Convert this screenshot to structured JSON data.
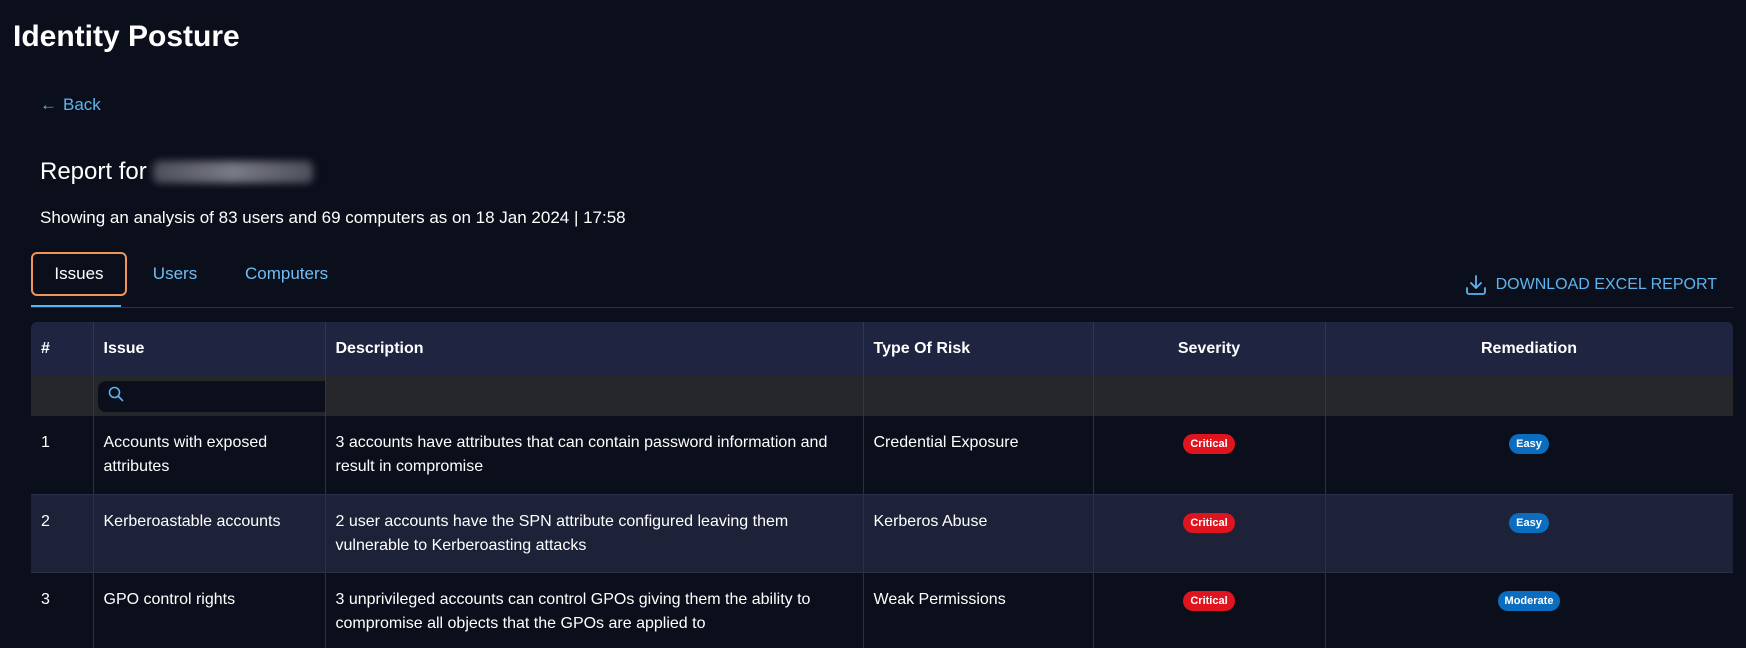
{
  "page": {
    "title": "Identity Posture",
    "back_label": "Back",
    "report_title_prefix": "Report for",
    "analysis_text": "Showing an analysis of 83 users and 69 computers as on 18 Jan 2024 | 17:58"
  },
  "tabs": [
    {
      "label": "Issues",
      "active": true
    },
    {
      "label": "Users",
      "active": false
    },
    {
      "label": "Computers",
      "active": false
    }
  ],
  "download": {
    "label": "DOWNLOAD EXCEL REPORT",
    "icon": "download-tray-icon"
  },
  "colors": {
    "background": "#0b0e1b",
    "header": "#1f2540",
    "accent": "#5eb4f0",
    "active_tab_border": "#f0955a",
    "critical": "#e0141e",
    "remediation_badge": "#0a6dbf"
  },
  "table": {
    "columns": [
      "#",
      "Issue",
      "Description",
      "Type Of Risk",
      "Severity",
      "Remediation"
    ],
    "search": {
      "placeholder": "",
      "icon": "search-icon"
    },
    "rows": [
      {
        "num": "1",
        "issue": "Accounts with exposed attributes",
        "description": "3 accounts have attributes that can contain password information and result in compromise",
        "risk": "Credential Exposure",
        "severity": "Critical",
        "remediation": "Easy"
      },
      {
        "num": "2",
        "issue": "Kerberoastable accounts",
        "description": "2 user accounts have the SPN attribute configured leaving them vulnerable to Kerberoasting attacks",
        "risk": "Kerberos Abuse",
        "severity": "Critical",
        "remediation": "Easy"
      },
      {
        "num": "3",
        "issue": "GPO control rights",
        "description": "3 unprivileged accounts can control GPOs giving them the ability to compromise all objects that the GPOs are applied to",
        "risk": "Weak Permissions",
        "severity": "Critical",
        "remediation": "Moderate"
      }
    ]
  }
}
